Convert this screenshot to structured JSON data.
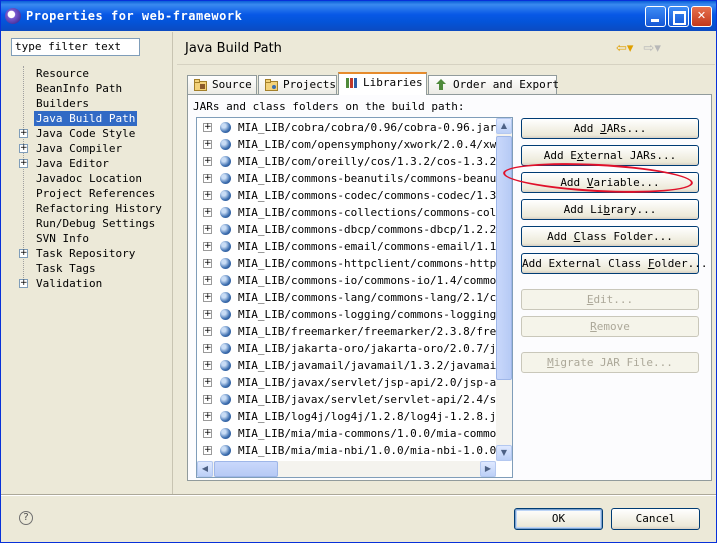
{
  "window": {
    "title": "Properties for web-framework",
    "minimize": "_",
    "maximize": "□",
    "close": "✕"
  },
  "filter": {
    "value": "type filter text"
  },
  "nav": {
    "items": [
      {
        "label": "Resource",
        "expandable": false
      },
      {
        "label": "BeanInfo Path",
        "expandable": false
      },
      {
        "label": "Builders",
        "expandable": false
      },
      {
        "label": "Java Build Path",
        "expandable": false,
        "selected": true
      },
      {
        "label": "Java Code Style",
        "expandable": true
      },
      {
        "label": "Java Compiler",
        "expandable": true
      },
      {
        "label": "Java Editor",
        "expandable": true
      },
      {
        "label": "Javadoc Location",
        "expandable": false
      },
      {
        "label": "Project References",
        "expandable": false
      },
      {
        "label": "Refactoring History",
        "expandable": false
      },
      {
        "label": "Run/Debug Settings",
        "expandable": false
      },
      {
        "label": "SVN Info",
        "expandable": false
      },
      {
        "label": "Task Repository",
        "expandable": true
      },
      {
        "label": "Task Tags",
        "expandable": false
      },
      {
        "label": "Validation",
        "expandable": true
      }
    ]
  },
  "page": {
    "title": "Java Build Path"
  },
  "tabs": [
    {
      "label": "Source",
      "icon": "source-folder-icon"
    },
    {
      "label": "Projects",
      "icon": "projects-icon"
    },
    {
      "label": "Libraries",
      "icon": "libraries-icon",
      "active": true
    },
    {
      "label": "Order and Export",
      "icon": "order-export-icon"
    }
  ],
  "libraries": {
    "label": "JARs and class folders on the build path:",
    "entries": [
      "MIA_LIB/cobra/cobra/0.96/cobra-0.96.jar - D",
      "MIA_LIB/com/opensymphony/xwork/2.0.4/xwork-",
      "MIA_LIB/com/oreilly/cos/1.3.2/cos-1.3.2.jar",
      "MIA_LIB/commons-beanutils/commons-beanutils",
      "MIA_LIB/commons-codec/commons-codec/1.3/com",
      "MIA_LIB/commons-collections/commons-collect",
      "MIA_LIB/commons-dbcp/commons-dbcp/1.2.2/com",
      "MIA_LIB/commons-email/commons-email/1.1/com",
      "MIA_LIB/commons-httpclient/commons-httpclie",
      "MIA_LIB/commons-io/commons-io/1.4/commons-i",
      "MIA_LIB/commons-lang/commons-lang/2.1/commo",
      "MIA_LIB/commons-logging/commons-logging/1.0",
      "MIA_LIB/freemarker/freemarker/2.3.8/freemar",
      "MIA_LIB/jakarta-oro/jakarta-oro/2.0.7/jakar",
      "MIA_LIB/javamail/javamail/1.3.2/javamail-1.",
      "MIA_LIB/javax/servlet/jsp-api/2.0/jsp-api-2",
      "MIA_LIB/javax/servlet/servlet-api/2.4/servl",
      "MIA_LIB/log4j/log4j/1.2.8/log4j-1.2.8.jar -",
      "MIA_LIB/mia/mia-commons/1.0.0/mia-commons-1",
      "MIA_LIB/mia/mia-nbi/1.0.0/mia-nbi-1.0.0.jar"
    ]
  },
  "buttons": {
    "add_jars": {
      "pre": "Add ",
      "key": "J",
      "post": "ARs..."
    },
    "add_external_jars": {
      "pre": "Add E",
      "key": "x",
      "post": "ternal JARs..."
    },
    "add_variable": {
      "pre": "Add ",
      "key": "V",
      "post": "ariable..."
    },
    "add_library": {
      "pre": "Add Li",
      "key": "b",
      "post": "rary..."
    },
    "add_class_folder": {
      "pre": "Add ",
      "key": "C",
      "post": "lass Folder..."
    },
    "add_external_class_folder": {
      "pre": "Add External Class ",
      "key": "F",
      "post": "older..."
    },
    "edit": {
      "pre": "",
      "key": "E",
      "post": "dit..."
    },
    "remove": {
      "pre": "",
      "key": "R",
      "post": "emove"
    },
    "migrate": {
      "pre": "",
      "key": "M",
      "post": "igrate JAR File..."
    }
  },
  "dialog": {
    "ok": "OK",
    "cancel": "Cancel",
    "help": "?"
  },
  "colors": {
    "selection": "#316ac5",
    "annotation": "#e0102a",
    "tab_accent": "#e68b2c"
  }
}
